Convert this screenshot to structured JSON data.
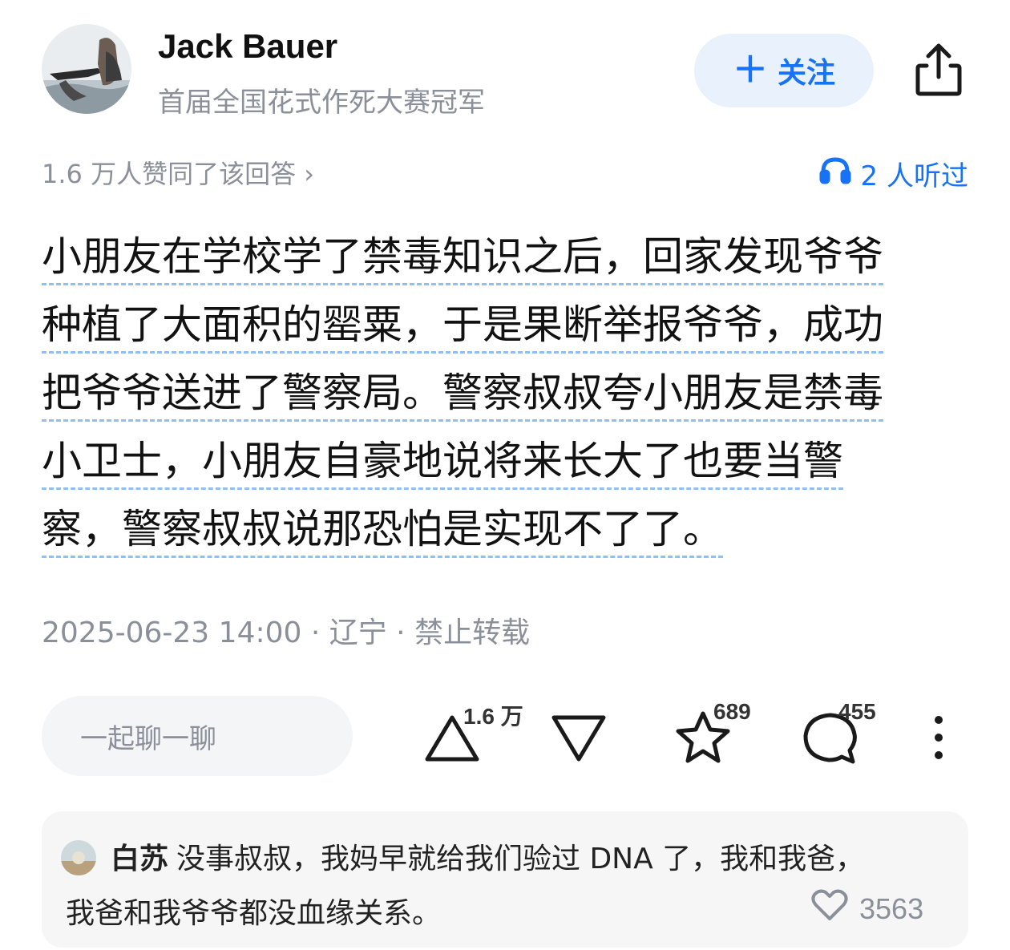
{
  "author": {
    "name": "Jack Bauer",
    "bio": "首届全国花式作死大赛冠军"
  },
  "follow_button": {
    "icon": "plus-icon",
    "label": "关注"
  },
  "share_icon": "share-icon",
  "approval_text": "1.6 万人赞同了该回答 ›",
  "listen": {
    "icon": "headphones-icon",
    "text": "2 人听过"
  },
  "answer_lines": [
    "小朋友在学校学了禁毒知识之后，回家发现爷爷",
    "种植了大面积的罂粟，于是果断举报爷爷，成功",
    "把爷爷送进了警察局。警察叔叔夸小朋友是禁毒",
    "小卫士，小朋友自豪地说将来长大了也要当警",
    "察，警察叔叔说那恐怕是实现不了了。"
  ],
  "post_meta": "2025-06-23 14:00 · 辽宁 · 禁止转载",
  "action_bar": {
    "chat_placeholder": "一起聊一聊",
    "upvote_count": "1.6 万",
    "favorite_count": "689",
    "comment_count": "455"
  },
  "accent_color": "#1772f6",
  "top_comment": {
    "author": "白苏",
    "line1": "没事叔叔，我妈早就给我们验过 DNA 了，我和我爸，",
    "line2": "我爸和我爷爷都没血缘关系。",
    "likes": "3563"
  }
}
